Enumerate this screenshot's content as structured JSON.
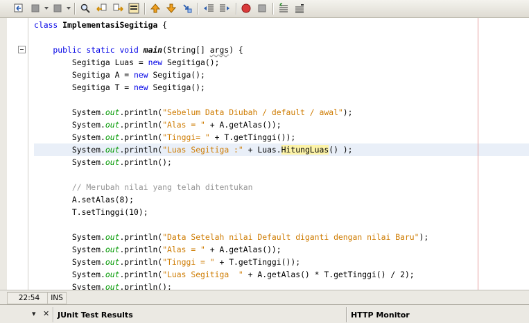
{
  "toolbar": {
    "icons": [
      "last-edit-icon",
      "back-icon",
      "forward-icon",
      "find-icon",
      "find-previous-icon",
      "find-next-icon",
      "toggle-highlight-icon",
      "previous-bookmark-icon",
      "next-bookmark-icon",
      "toggle-bookmark-icon",
      "shift-left-icon",
      "shift-right-icon",
      "start-macro-icon",
      "stop-macro-icon",
      "comment-icon",
      "uncomment-icon"
    ]
  },
  "editor": {
    "lines": [
      {
        "segments": [
          {
            "t": "class ",
            "c": "kw0"
          },
          {
            "t": "ImplementasiSegitiga",
            "c": "bold"
          },
          {
            "t": " {",
            "c": ""
          }
        ]
      },
      {
        "segments": []
      },
      {
        "segments": [
          {
            "t": "    public static void ",
            "c": "kw"
          },
          {
            "t": "main",
            "c": "boldit"
          },
          {
            "t": "(String[] ",
            "c": ""
          },
          {
            "t": "args",
            "c": "wavy"
          },
          {
            "t": ") {",
            "c": ""
          }
        ]
      },
      {
        "segments": [
          {
            "t": "        Segitiga Luas = ",
            "c": ""
          },
          {
            "t": "new",
            "c": "kw"
          },
          {
            "t": " Segitiga();",
            "c": ""
          }
        ]
      },
      {
        "segments": [
          {
            "t": "        Segitiga A = ",
            "c": ""
          },
          {
            "t": "new",
            "c": "kw"
          },
          {
            "t": " Segitiga();",
            "c": ""
          }
        ]
      },
      {
        "segments": [
          {
            "t": "        Segitiga T = ",
            "c": ""
          },
          {
            "t": "new",
            "c": "kw"
          },
          {
            "t": " Segitiga();",
            "c": ""
          }
        ]
      },
      {
        "segments": []
      },
      {
        "segments": [
          {
            "t": "        System.",
            "c": ""
          },
          {
            "t": "out",
            "c": "fld"
          },
          {
            "t": ".println(",
            "c": ""
          },
          {
            "t": "\"Sebelum Data Diubah / default / awal\"",
            "c": "st"
          },
          {
            "t": ");",
            "c": ""
          }
        ]
      },
      {
        "segments": [
          {
            "t": "        System.",
            "c": ""
          },
          {
            "t": "out",
            "c": "fld"
          },
          {
            "t": ".println(",
            "c": ""
          },
          {
            "t": "\"Alas = \"",
            "c": "st"
          },
          {
            "t": " + A.getAlas());",
            "c": ""
          }
        ]
      },
      {
        "segments": [
          {
            "t": "        System.",
            "c": ""
          },
          {
            "t": "out",
            "c": "fld"
          },
          {
            "t": ".println(",
            "c": ""
          },
          {
            "t": "\"Tinggi= \"",
            "c": "st"
          },
          {
            "t": " + T.getTinggi());",
            "c": ""
          }
        ]
      },
      {
        "segments": [
          {
            "t": "        System.",
            "c": ""
          },
          {
            "t": "out",
            "c": "fld"
          },
          {
            "t": ".println(",
            "c": ""
          },
          {
            "t": "\"Luas Segitiga :\"",
            "c": "st"
          },
          {
            "t": " + Luas.",
            "c": ""
          },
          {
            "t": "HitungLuas",
            "c": "mark"
          },
          {
            "t": "() );",
            "c": ""
          }
        ]
      },
      {
        "segments": [
          {
            "t": "        System.",
            "c": ""
          },
          {
            "t": "out",
            "c": "fld"
          },
          {
            "t": ".println();",
            "c": ""
          }
        ]
      },
      {
        "segments": []
      },
      {
        "segments": [
          {
            "t": "        // Merubah nilai yang telah ditentukan",
            "c": "cm"
          }
        ]
      },
      {
        "segments": [
          {
            "t": "        A.setAlas(8);",
            "c": ""
          }
        ]
      },
      {
        "segments": [
          {
            "t": "        T.setTinggi(10);",
            "c": ""
          }
        ]
      },
      {
        "segments": []
      },
      {
        "segments": [
          {
            "t": "        System.",
            "c": ""
          },
          {
            "t": "out",
            "c": "fld"
          },
          {
            "t": ".println(",
            "c": ""
          },
          {
            "t": "\"Data Setelah nilai Default diganti dengan nilai Baru\"",
            "c": "st"
          },
          {
            "t": ");",
            "c": ""
          }
        ]
      },
      {
        "segments": [
          {
            "t": "        System.",
            "c": ""
          },
          {
            "t": "out",
            "c": "fld"
          },
          {
            "t": ".println(",
            "c": ""
          },
          {
            "t": "\"Alas = \"",
            "c": "st"
          },
          {
            "t": " + A.getAlas());",
            "c": ""
          }
        ]
      },
      {
        "segments": [
          {
            "t": "        System.",
            "c": ""
          },
          {
            "t": "out",
            "c": "fld"
          },
          {
            "t": ".println(",
            "c": ""
          },
          {
            "t": "\"Tinggi = \"",
            "c": "st"
          },
          {
            "t": " + T.getTinggi());",
            "c": ""
          }
        ]
      },
      {
        "segments": [
          {
            "t": "        System.",
            "c": ""
          },
          {
            "t": "out",
            "c": "fld"
          },
          {
            "t": ".println(",
            "c": ""
          },
          {
            "t": "\"Luas Segitiga  \"",
            "c": "st"
          },
          {
            "t": " + A.getAlas() * T.getTinggi() / 2);",
            "c": ""
          }
        ]
      },
      {
        "segments": [
          {
            "t": "        System.",
            "c": ""
          },
          {
            "t": "out",
            "c": "fld"
          },
          {
            "t": ".println();",
            "c": ""
          }
        ]
      }
    ]
  },
  "status": {
    "position": "22:54",
    "mode": "INS"
  },
  "bottom_panel": {
    "junit_tab": "JUnit Test Results",
    "http_tab": "HTTP Monitor",
    "dropdown_glyph": "▾",
    "close_glyph": "✕"
  },
  "colors": {
    "keyword": "#0000e6",
    "string": "#ce7b00",
    "comment": "#969696",
    "field": "#009900",
    "highlight_line": "#e9eff8",
    "margin_line": "#e39a9a",
    "mark": "#fcf3a8"
  }
}
